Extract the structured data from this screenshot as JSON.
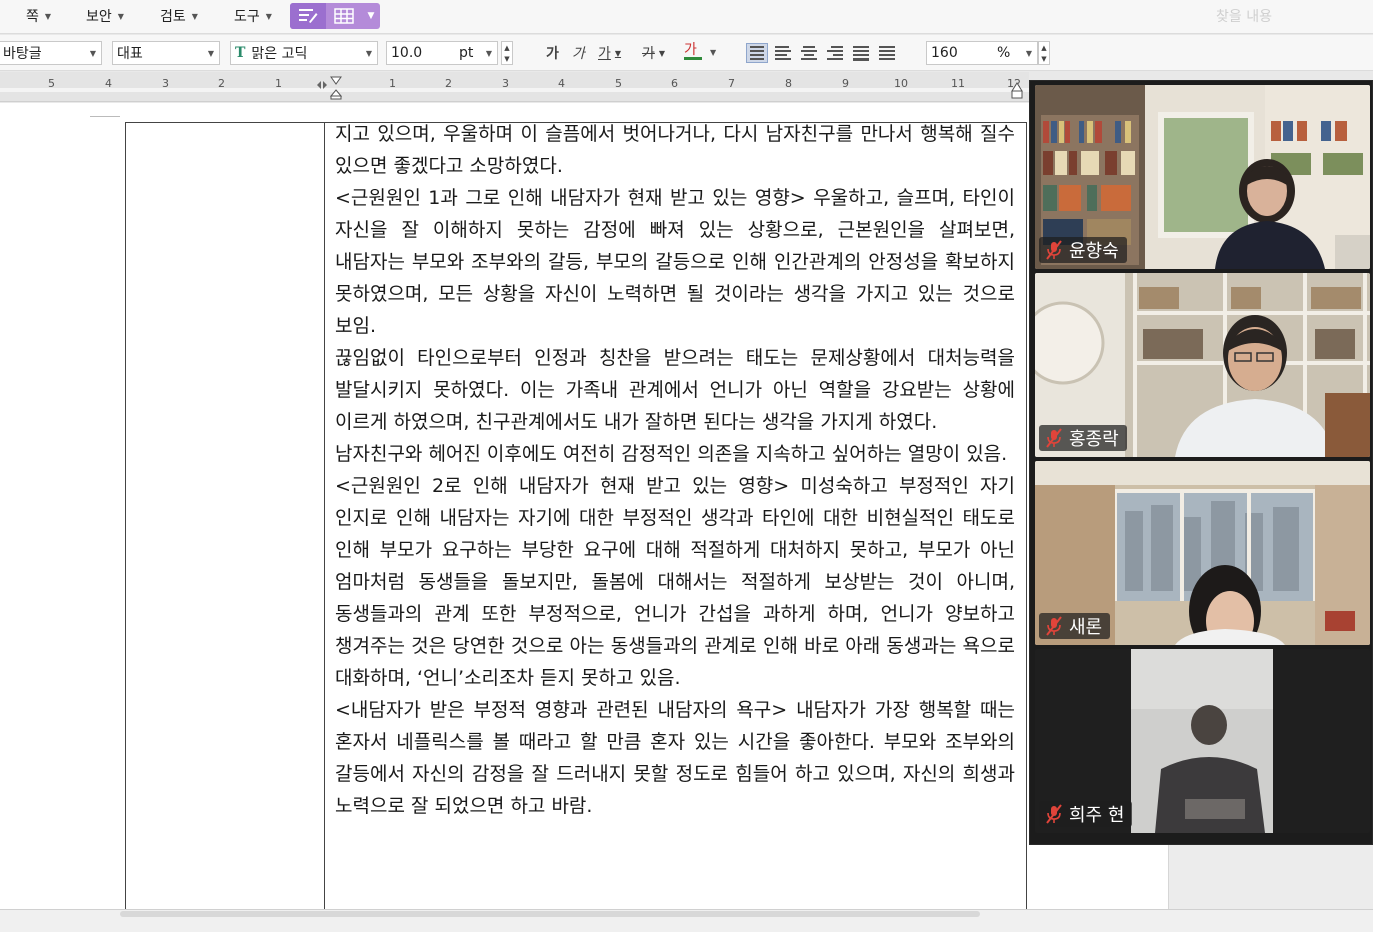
{
  "menubar": {
    "items": [
      {
        "label": "쪽"
      },
      {
        "label": "보안"
      },
      {
        "label": "검토"
      },
      {
        "label": "도구"
      }
    ],
    "find_label": "찾을 내용"
  },
  "format_toolbar": {
    "style": "바탕글",
    "lang": "대표",
    "font": "맑은 고딕",
    "font_size": "10.0",
    "size_unit": "pt",
    "bold": "가",
    "italic": "가",
    "underline": "가",
    "strike": "가",
    "color": "가",
    "line_spacing": "160",
    "spacing_unit": "%"
  },
  "ruler": {
    "ticks": [
      "5",
      "4",
      "3",
      "2",
      "1",
      "1",
      "2",
      "3",
      "4",
      "5",
      "6",
      "7",
      "8",
      "9",
      "10",
      "11",
      "12"
    ]
  },
  "document": {
    "paragraphs": [
      "지고 있으며, 우울하며 이 슬픔에서 벗어나거나, 다시 남자친구를 만나서 행복해 질수 있으면 좋겠다고 소망하였다.",
      "<근원원인 1과 그로 인해 내담자가 현재 받고 있는 영향> 우울하고, 슬프며, 타인이 자신을 잘 이해하지 못하는 감정에 빠져 있는 상황으로, 근본원인을 살펴보면, 내담자는 부모와 조부와의 갈등, 부모의 갈등으로 인해 인간관계의 안정성을 확보하지 못하였으며, 모든 상황을 자신이 노력하면 될 것이라는 생각을 가지고 있는 것으로 보임.",
      "끊임없이 타인으로부터 인정과 칭찬을 받으려는 태도는 문제상황에서 대처능력을 발달시키지 못하였다. 이는 가족내 관계에서 언니가 아닌 역할을 강요받는 상황에 이르게 하였으며, 친구관계에서도 내가 잘하면 된다는 생각을 가지게 하였다.",
      "남자친구와 헤어진 이후에도 여전히 감정적인 의존을 지속하고 싶어하는 열망이 있음.",
      "<근원원인 2로 인해 내담자가 현재 받고 있는 영향> 미성숙하고 부정적인 자기 인지로 인해 내담자는 자기에 대한 부정적인 생각과 타인에 대한 비현실적인 태도로 인해 부모가 요구하는 부당한 요구에 대해 적절하게 대처하지 못하고, 부모가 아닌 엄마처럼 동생들을 돌보지만, 돌봄에 대해서는 적절하게 보상받는 것이 아니며, 동생들과의 관계 또한 부정적으로, 언니가 간섭을 과하게 하며, 언니가 양보하고 챙겨주는 것은 당연한 것으로 아는 동생들과의 관계로 인해 바로 아래 동생과는 욕으로 대화하며, ‘언니’소리조차 듣지 못하고 있음.",
      "<내담자가 받은 부정적 영향과 관련된 내담자의 욕구> 내담자가 가장 행복할 때는 혼자서 네플릭스를 볼 때라고 할 만큼 혼자 있는 시간을 좋아한다. 부모와 조부와의 갈등에서 자신의 감정을 잘 드러내지 못할 정도로 힘들어 하고 있으며, 자신의 희생과 노력으로 잘 되었으면 하고 바람."
    ]
  },
  "video_call": {
    "participants": [
      {
        "name": "윤향숙",
        "muted": true
      },
      {
        "name": "홍종락",
        "muted": true
      },
      {
        "name": "새론",
        "muted": true
      },
      {
        "name": "희주 현",
        "muted": true
      }
    ]
  },
  "colors": {
    "accent_purple": "#9b6fcf",
    "muted_red": "#e0443a"
  }
}
